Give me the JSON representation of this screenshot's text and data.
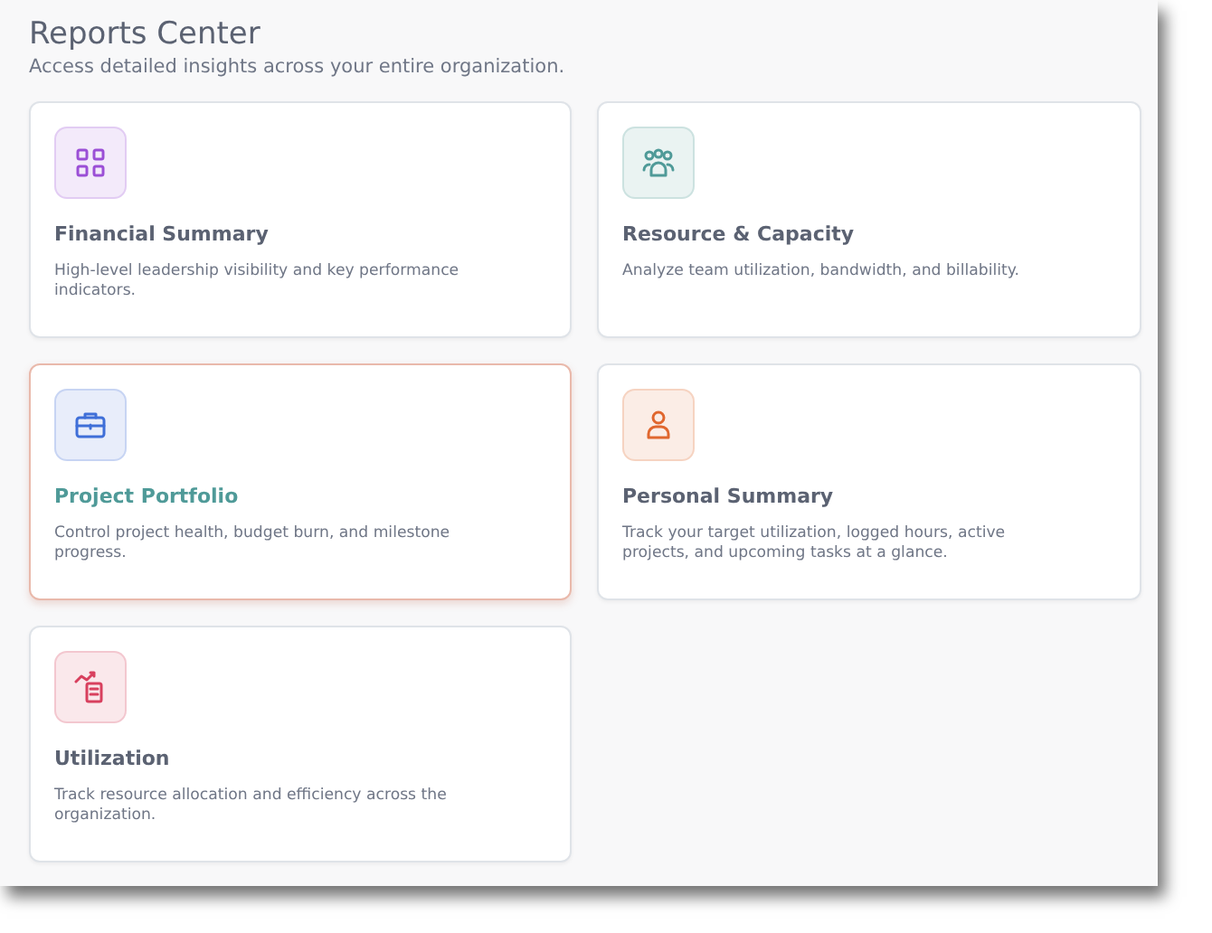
{
  "header": {
    "title": "Reports Center",
    "subtitle": "Access detailed insights across your entire organization."
  },
  "cards": [
    {
      "kind": "grid",
      "color": "#9b4fd6",
      "title": "Financial Summary",
      "description": "High-level leadership visibility and key performance indicators.",
      "selected": false
    },
    {
      "kind": "team",
      "color": "#4f9a98",
      "title": "Resource & Capacity",
      "description": "Analyze team utilization, bandwidth, and billability.",
      "selected": false
    },
    {
      "kind": "briefcase",
      "color": "#3f6fd8",
      "title": "Project Portfolio",
      "description": "Control project health, budget burn, and milestone progress.",
      "selected": true
    },
    {
      "kind": "person",
      "color": "#e0672e",
      "title": "Personal Summary",
      "description": "Track your target utilization, logged hours, active projects, and upcoming tasks at a glance.",
      "selected": false
    },
    {
      "kind": "trend",
      "color": "#d8405e",
      "title": "Utilization",
      "description": "Track resource allocation and efficiency across the organization.",
      "selected": false
    }
  ]
}
